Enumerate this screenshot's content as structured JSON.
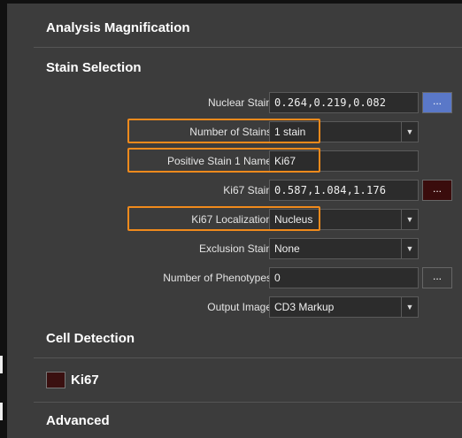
{
  "sections": {
    "analysis_magnification": "Analysis Magnification",
    "stain_selection": "Stain Selection",
    "cell_detection": "Cell Detection",
    "ki67_item": "Ki67",
    "advanced": "Advanced"
  },
  "fields": {
    "nuclear_stain": {
      "label": "Nuclear Stain",
      "value": "0.264,0.219,0.082",
      "button": "..."
    },
    "number_of_stains": {
      "label": "Number of Stains",
      "value": "1 stain"
    },
    "positive_stain_1_name": {
      "label": "Positive Stain 1 Name",
      "value": "Ki67"
    },
    "ki67_stain": {
      "label": "Ki67 Stain",
      "value": "0.587,1.084,1.176",
      "button": "..."
    },
    "ki67_localization": {
      "label": "Ki67 Localization",
      "value": "Nucleus"
    },
    "exclusion_stain": {
      "label": "Exclusion Stain",
      "value": "None"
    },
    "number_of_phenotypes": {
      "label": "Number of Phenotypes",
      "value": "0",
      "button": "..."
    },
    "output_image": {
      "label": "Output Image",
      "value": "CD3 Markup"
    }
  },
  "colors": {
    "highlight": "#f08a1c",
    "nuclear_stain_swatch": "#5a78c8",
    "ki67_stain_swatch": "#3a0c0c",
    "ki67_legend_swatch": "#3a1010",
    "panel_bg": "#3c3c3c"
  },
  "icons": {
    "dropdown": "chevron-down-icon"
  }
}
